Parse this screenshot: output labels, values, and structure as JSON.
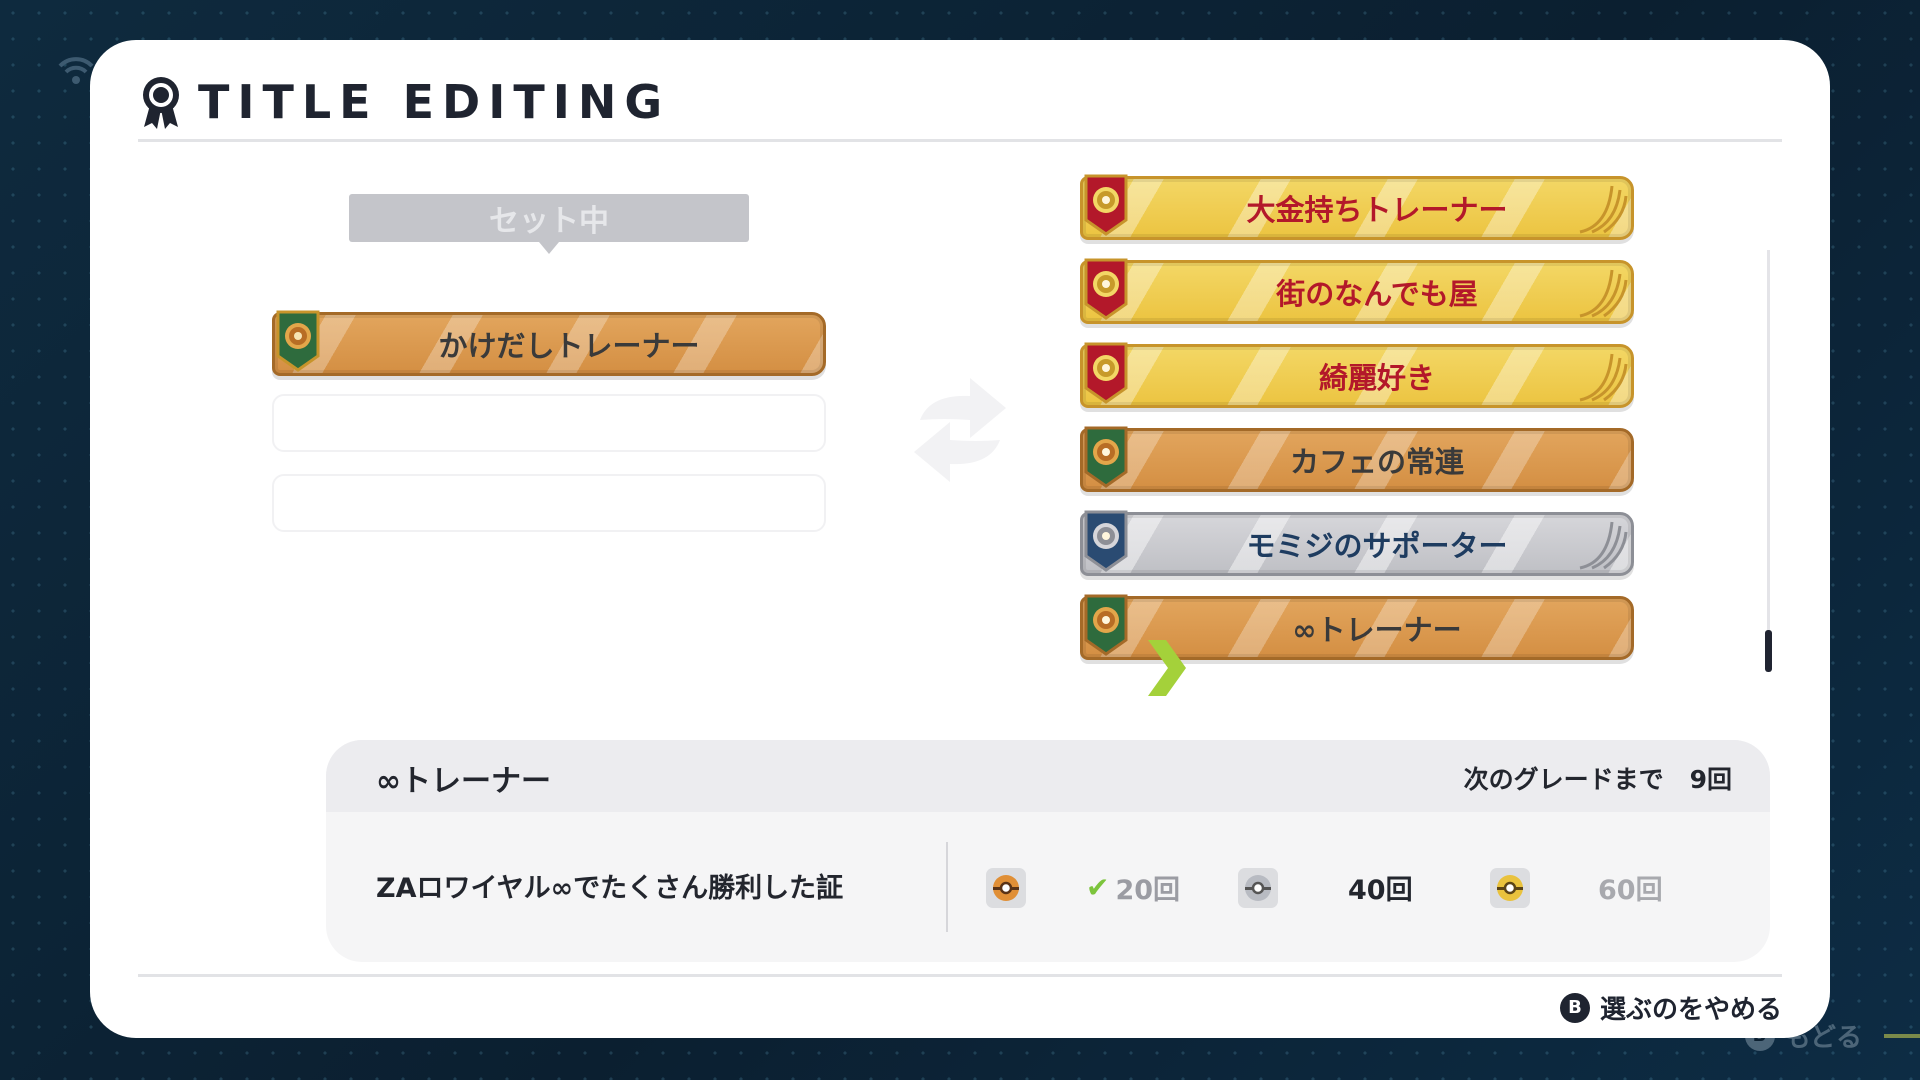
{
  "header": {
    "title": "TITLE EDITING"
  },
  "left": {
    "set_label": "セット中",
    "current_title": "かけだしトレーナー",
    "current_tier": "bronze"
  },
  "titles": [
    {
      "label": "大金持ちトレーナー",
      "tier": "gold"
    },
    {
      "label": "街のなんでも屋",
      "tier": "gold"
    },
    {
      "label": "綺麗好き",
      "tier": "gold"
    },
    {
      "label": "カフェの常連",
      "tier": "bronze"
    },
    {
      "label": "モミジのサポーター",
      "tier": "silver"
    },
    {
      "label": "∞トレーナー",
      "tier": "bronze",
      "selected": true
    }
  ],
  "info": {
    "name": "∞トレーナー",
    "next_grade_label": "次のグレードまで",
    "next_grade_value": "9回",
    "description": "ZAロワイヤル∞でたくさん勝利した証",
    "tiers": [
      {
        "icon": "bronze-ball-icon",
        "count": "20回",
        "status": "achieved"
      },
      {
        "icon": "silver-ball-icon",
        "count": "40回",
        "status": "next"
      },
      {
        "icon": "gold-ball-icon",
        "count": "60回",
        "status": "locked"
      }
    ]
  },
  "footer": {
    "button_key": "B",
    "cancel_label": "選ぶのをやめる"
  },
  "background": {
    "back_key": "B",
    "back_label": "もどる"
  },
  "colors": {
    "gold_text": "#b3182a",
    "silver_text": "#1e3c60",
    "bronze_text": "#3a3a3a",
    "check": "#7cc43c"
  }
}
